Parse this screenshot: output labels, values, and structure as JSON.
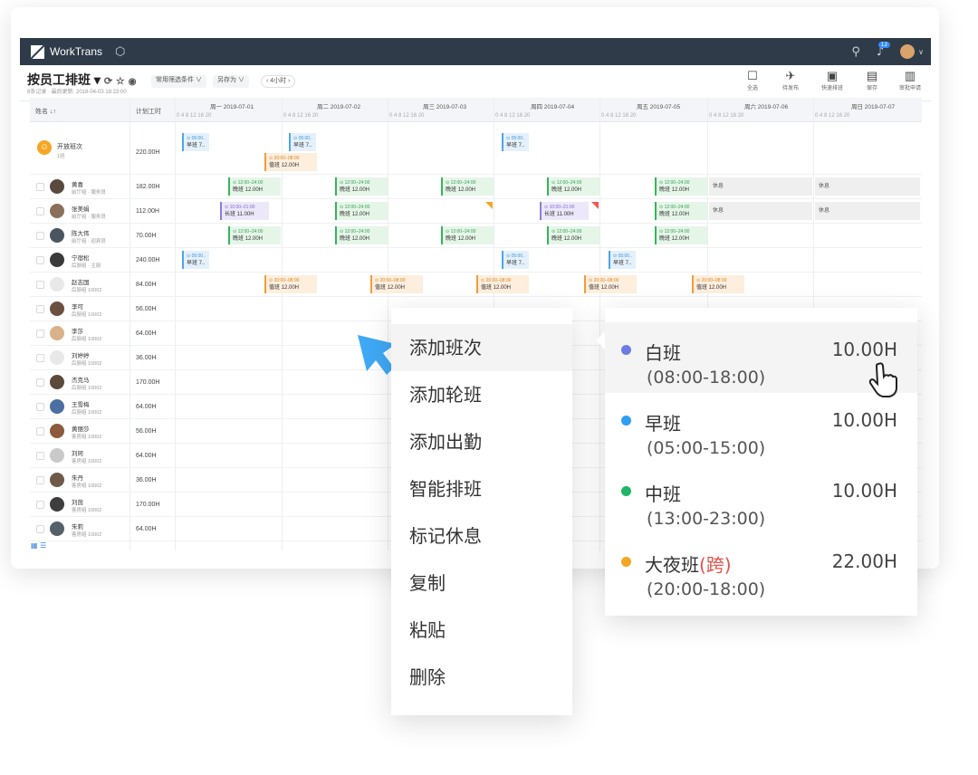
{
  "app": {
    "name": "WorkTrans",
    "notif_count": "12"
  },
  "colors": {
    "topbar": "#2f3b48",
    "accent": "#3b86d9",
    "arrow": "#3fa9f5"
  },
  "page": {
    "title": "按员工排班 ▾",
    "subtitle": "8条记录 · 最后更新: 2018-04-03 18:23:00"
  },
  "toolbar": {
    "filter": "常用筛选条件 ∨",
    "save_as": "另存为 ∨",
    "interval": "‹  4小时  ›",
    "actions": [
      {
        "label": "全选",
        "icon": "square-icon"
      },
      {
        "label": "待发布",
        "icon": "send-icon"
      },
      {
        "label": "快速排班",
        "icon": "calendar-icon"
      },
      {
        "label": "保存",
        "icon": "save-icon"
      },
      {
        "label": "审批申请",
        "icon": "approve-icon"
      }
    ]
  },
  "grid": {
    "col_name": "姓名 ↓↑",
    "col_hours": "计划工时",
    "hour_ticks": "0    4    8    12    16    20",
    "days": [
      "周一  2019-07-01",
      "周二  2019-07-02",
      "周三  2019-07-03",
      "周四  2019-07-04",
      "周五  2019-07-05",
      "周六  2019-07-06",
      "周日  2019-07-07"
    ],
    "open_row": {
      "name": "开放班次",
      "sub": "1班",
      "hours": "220.00H"
    },
    "rows": [
      {
        "name": "黄喜",
        "id": "10001",
        "dept": "前厅组 · 服务员",
        "hours": "182.00H"
      },
      {
        "name": "张美娟",
        "id": "10002",
        "dept": "前厅组 · 服务员",
        "hours": "112.00H"
      },
      {
        "name": "陈大伟",
        "id": "10003",
        "dept": "前厅组 · 迎宾员",
        "hours": "70.00H"
      },
      {
        "name": "宁宿松",
        "id": "10003",
        "dept": "后厨组 · 主厨",
        "hours": "240.00H"
      },
      {
        "name": "赵志国",
        "id": "",
        "dept": "后厨组  10002",
        "hours": "84.00H"
      },
      {
        "name": "李可",
        "id": "",
        "dept": "后厨组  10002",
        "hours": "56.00H"
      },
      {
        "name": "李莎",
        "id": "",
        "dept": "后厨组  10002",
        "hours": "64.00H"
      },
      {
        "name": "刘婷婷",
        "id": "",
        "dept": "后厨组  10002",
        "hours": "36.00H"
      },
      {
        "name": "杰克马",
        "id": "",
        "dept": "后厨组  10002",
        "hours": "170.00H"
      },
      {
        "name": "王雪梅",
        "id": "",
        "dept": "后厨组  10002",
        "hours": "64.00H"
      },
      {
        "name": "黄丽莎",
        "id": "",
        "dept": "客房组  10002",
        "hours": "56.00H"
      },
      {
        "name": "刘珂",
        "id": "",
        "dept": "客房组  10002",
        "hours": "64.00H"
      },
      {
        "name": "朱丹",
        "id": "",
        "dept": "客房组  10002",
        "hours": "36.00H"
      },
      {
        "name": "刘茵",
        "id": "",
        "dept": "客房组  10002",
        "hours": "170.00H"
      },
      {
        "name": "朱莉",
        "id": "",
        "dept": "客房组  10002",
        "hours": "64.00H"
      }
    ],
    "shift_text": {
      "early_time": "⊙ 05:00..",
      "early_name": "早班 7..",
      "late_time": "⊙ 12:00–24:00",
      "late_name": "晚班 12.00H",
      "long_time": "⊙ 10:00–21:00",
      "long_name": "长班 11.00H",
      "night_time": "⊙ 20:00–08:00",
      "night_name": "值班 12.00H",
      "rest": "休息"
    }
  },
  "context_menu": [
    "添加班次",
    "添加轮班",
    "添加出勤",
    "智能排班",
    "标记休息",
    "复制",
    "粘贴",
    "删除"
  ],
  "shift_options": [
    {
      "name": "白班",
      "time": "(08:00-18:00)",
      "hours": "10.00H",
      "color": "#6c7ee1"
    },
    {
      "name": "早班",
      "time": "(05:00-15:00)",
      "hours": "10.00H",
      "color": "#2e9ef0"
    },
    {
      "name": "中班",
      "time": "(13:00-23:00)",
      "hours": "10.00H",
      "color": "#1fb565"
    },
    {
      "name": "大夜班",
      "cross": "(跨)",
      "time": "(20:00-18:00)",
      "hours": "22.00H",
      "color": "#f5a623"
    }
  ]
}
